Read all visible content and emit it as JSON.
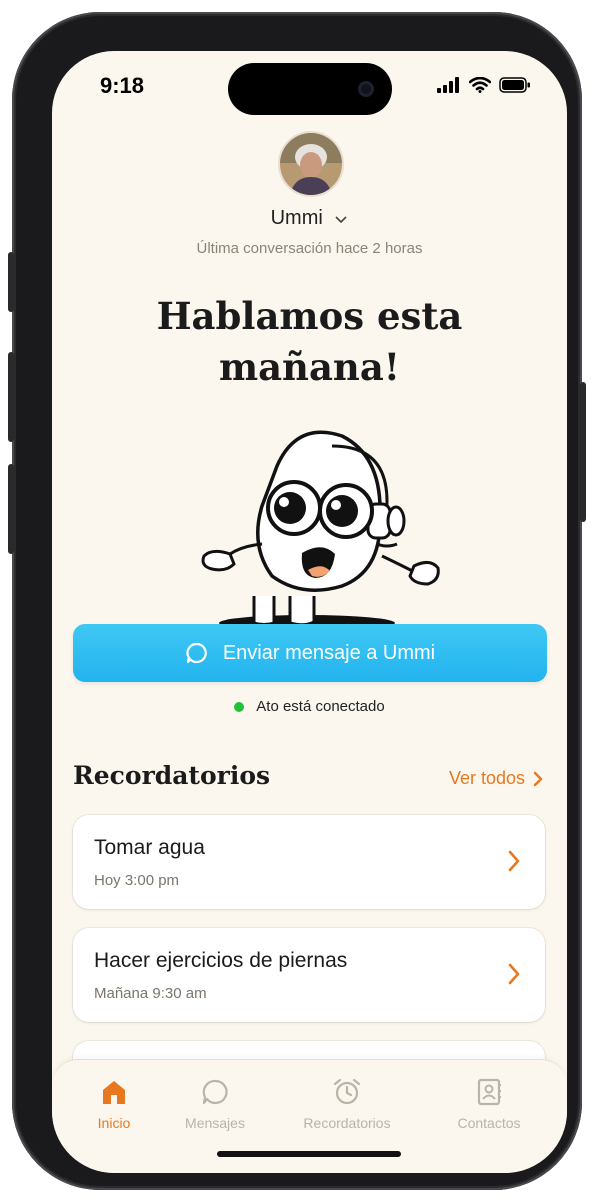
{
  "status_bar": {
    "time": "9:18"
  },
  "profile": {
    "name": "Ummi",
    "last_conversation": "Última conversación hace 2 horas"
  },
  "headline": "Hablamos esta mañana!",
  "primary_action": {
    "label": "Enviar mensaje a Ummi",
    "icon": "chat-bubble-icon"
  },
  "connection": {
    "text": "Ato está conectado",
    "status_color": "#21C23A"
  },
  "reminders": {
    "title": "Recordatorios",
    "see_all": "Ver todos",
    "items": [
      {
        "title": "Tomar agua",
        "time": "Hoy 3:00 pm"
      },
      {
        "title": "Hacer ejercicios de piernas",
        "time": "Mañana 9:30 am"
      }
    ]
  },
  "tabbar": {
    "tabs": [
      {
        "label": "Inicio",
        "icon": "home-icon",
        "active": true
      },
      {
        "label": "Mensajes",
        "icon": "chat-bubble-icon",
        "active": false
      },
      {
        "label": "Recordatorios",
        "icon": "alarm-clock-icon",
        "active": false
      },
      {
        "label": "Contactos",
        "icon": "contacts-book-icon",
        "active": false
      }
    ]
  },
  "colors": {
    "background": "#FBF7EE",
    "accent": "#E8781F",
    "cta": "#22B3EE"
  }
}
